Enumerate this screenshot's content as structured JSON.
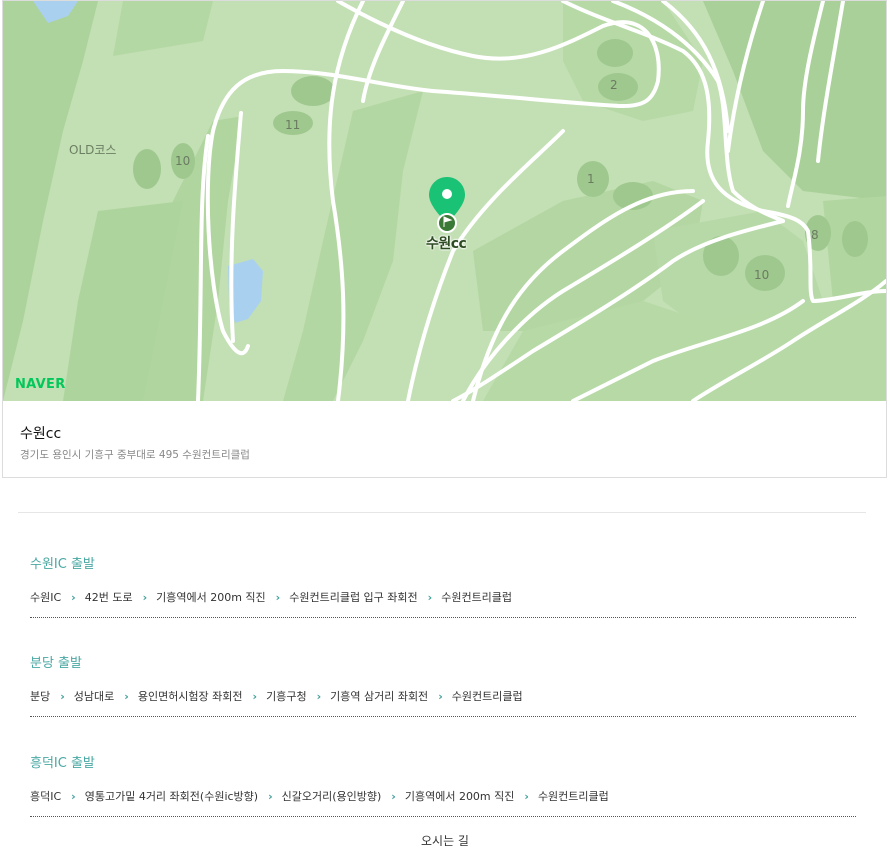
{
  "map": {
    "course_label": "OLD코스",
    "holes": [
      "11",
      "10",
      "2",
      "1",
      "8",
      "10"
    ],
    "pin_label": "수원cc",
    "logo": "NAVER",
    "colors": {
      "fairway": "#c3dfb4",
      "rough": "#acd39b",
      "road": "#ffffff",
      "water": "#a9d1ef",
      "pin": "#19c274"
    }
  },
  "place": {
    "name": "수원cc",
    "address": "경기도 용인시 기흥구 중부대로 495 수원컨트리클럽"
  },
  "routes": [
    {
      "title": "수원IC 출발",
      "steps": [
        "수원IC",
        "42번 도로",
        "기흥역에서 200m 직진",
        "수원컨트리클럽 입구 좌회전",
        "수원컨트리클럽"
      ]
    },
    {
      "title": "분당 출발",
      "steps": [
        "분당",
        "성남대로",
        "용인면허시험장 좌회전",
        "기흥구청",
        "기흥역 삼거리 좌회전",
        "수원컨트리클럽"
      ]
    },
    {
      "title": "흥덕IC 출발",
      "steps": [
        "흥덕IC",
        "영통고가밑 4거리 좌회전(수원ic방향)",
        "신갈오거리(용인방향)",
        "기흥역에서 200m 직진",
        "수원컨트리클럽"
      ]
    }
  ],
  "footer": {
    "label": "오시는 길"
  }
}
